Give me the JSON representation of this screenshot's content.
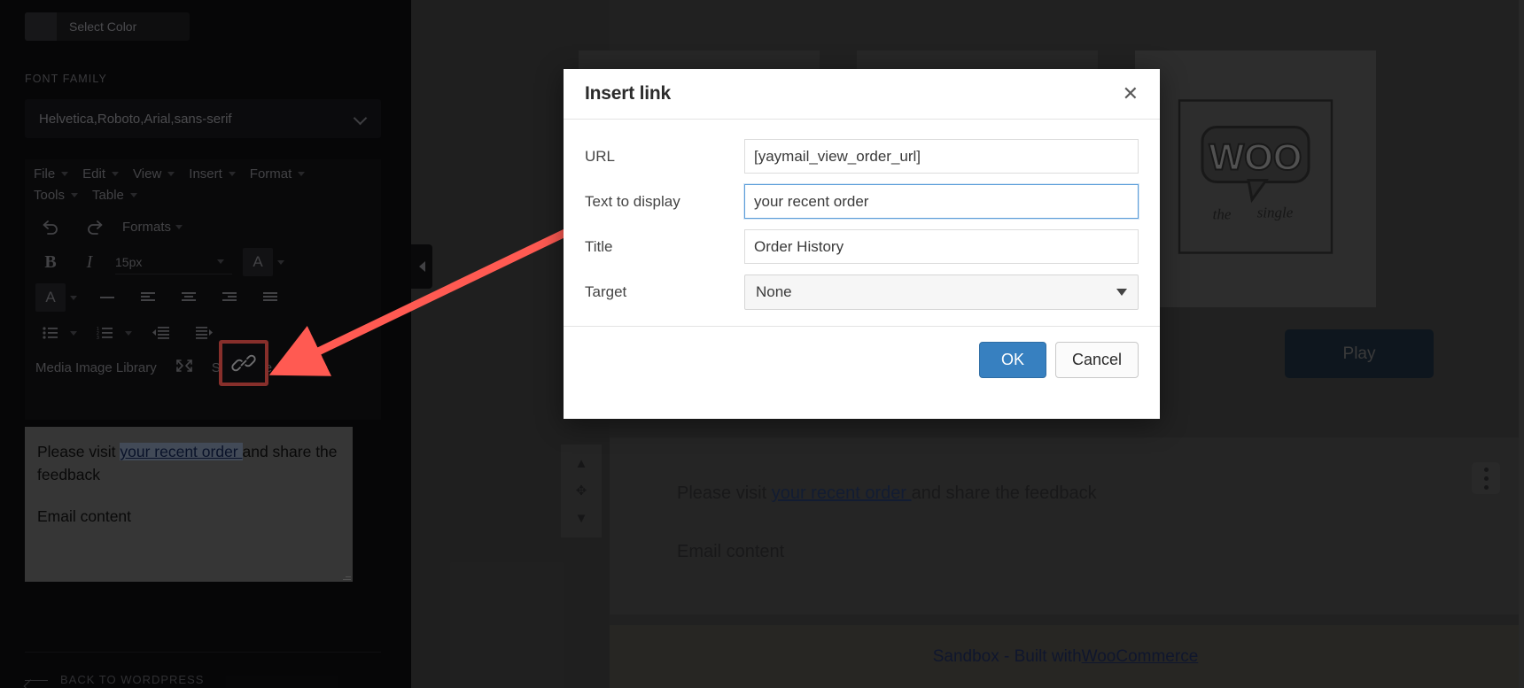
{
  "sidebar": {
    "color_picker": {
      "label": "Select Color",
      "swatch": "#2c2c30"
    },
    "font_family_section_label": "FONT FAMILY",
    "font_family_value": "Helvetica,Roboto,Arial,sans-serif",
    "menus": [
      "File",
      "Edit",
      "View",
      "Insert",
      "Format",
      "Tools",
      "Table"
    ],
    "formats_label": "Formats",
    "font_size_value": "15px",
    "media_row": {
      "media_image_library": "Media Image Library",
      "shortcode": "Shortcode"
    },
    "editor_text": {
      "line1_prefix": "Please visit ",
      "line1_link": "your recent order ",
      "line1_suffix": "and share the feedback",
      "line2": "Email content"
    },
    "back_to_wordpress": "BACK TO WORDPRESS"
  },
  "modal": {
    "title": "Insert link",
    "close_label": "✕",
    "fields": [
      {
        "label": "URL",
        "value": "[yaymail_view_order_url]",
        "type": "text",
        "focused": false
      },
      {
        "label": "Text to display",
        "value": "your recent order ",
        "type": "text",
        "focused": true
      },
      {
        "label": "Title",
        "value": "Order History",
        "type": "text",
        "focused": false
      },
      {
        "label": "Target",
        "value": "None",
        "type": "select",
        "focused": false
      }
    ],
    "ok_label": "OK",
    "cancel_label": "Cancel",
    "accent_color": "#3780c0"
  },
  "preview": {
    "play_button": "Play",
    "content": {
      "line1_prefix": "Please visit ",
      "line1_link": "your recent order ",
      "line1_suffix": "and share the feedback",
      "line2": "Email content"
    },
    "footer_prefix": "Sandbox - Built with ",
    "footer_link": "WooCommerce",
    "woo_logo_word": "WOO",
    "woo_logo_sub_a": "the",
    "woo_logo_sub_b": "single"
  },
  "annotation": {
    "highlight_color": "#ff5a52"
  }
}
